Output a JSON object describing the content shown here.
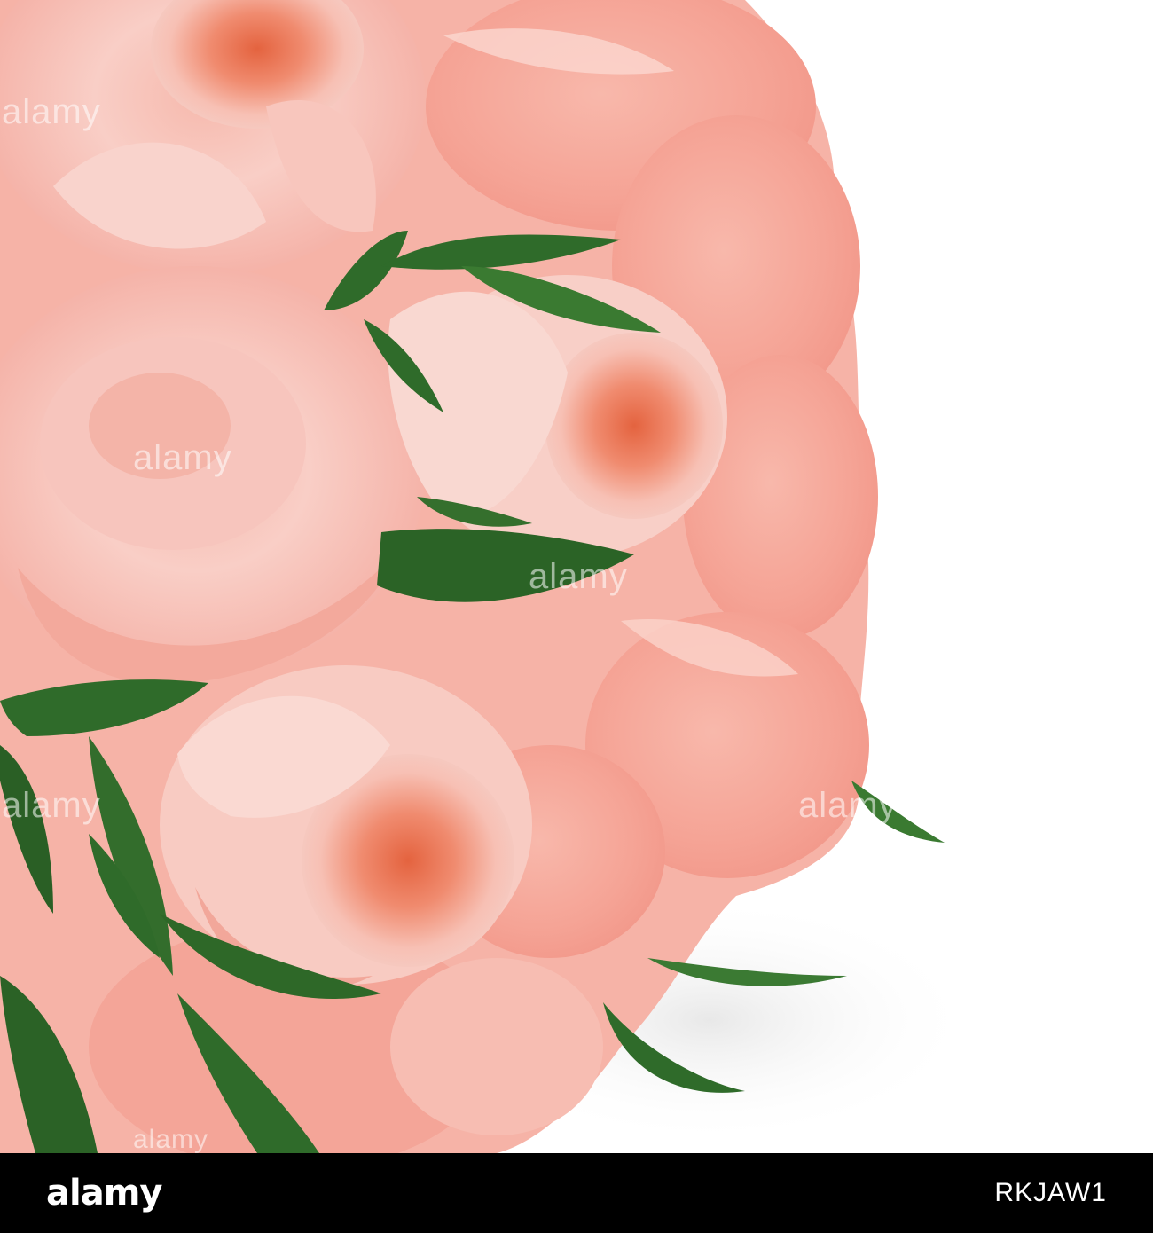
{
  "photo": {
    "subject": "pink-garden-roses-bouquet",
    "colors": {
      "petal_light": "#f7c4bc",
      "petal_mid": "#f2a59a",
      "petal_core": "#e86f52",
      "leaf": "#2f6b2a",
      "background": "#ffffff"
    }
  },
  "watermark": {
    "text": "alamy"
  },
  "footer": {
    "brand": "alamy",
    "image_id": "RKJAW1"
  }
}
